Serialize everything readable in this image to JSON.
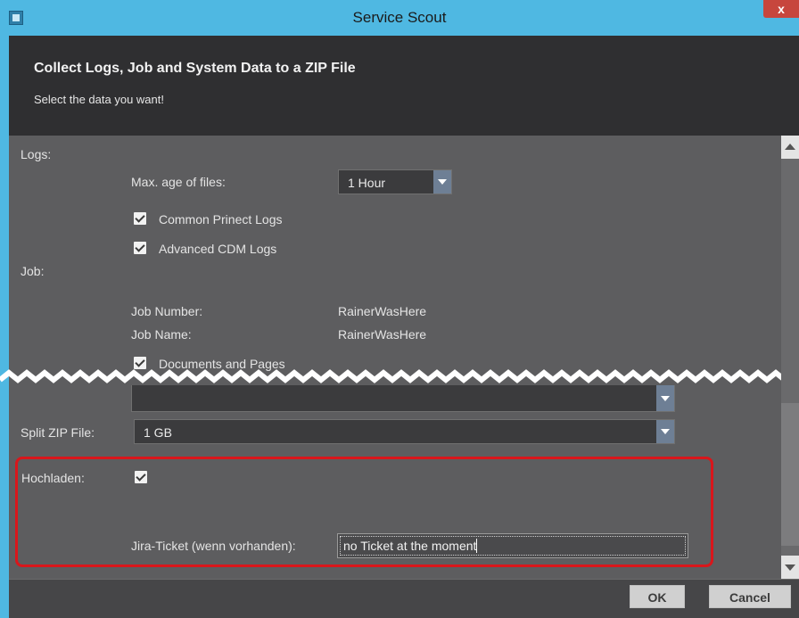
{
  "window": {
    "title": "Service Scout",
    "close_label": "x",
    "app_icon": "service-scout-icon"
  },
  "header": {
    "title": "Collect Logs, Job and System Data to a ZIP File",
    "subtitle": "Select the data you want!"
  },
  "logs": {
    "section_label": "Logs:",
    "max_age_label": "Max. age of files:",
    "max_age_value": "1 Hour",
    "checkboxes": [
      {
        "label": "Common Prinect Logs",
        "checked": true
      },
      {
        "label": "Advanced CDM Logs",
        "checked": true
      }
    ]
  },
  "job": {
    "section_label": "Job:",
    "number_label": "Job Number:",
    "number_value": "RainerWasHere",
    "name_label": "Job Name:",
    "name_value": "RainerWasHere",
    "documents_label": "Documents and Pages",
    "documents_checked": true
  },
  "split": {
    "label": "Split ZIP File:",
    "value": "1 GB"
  },
  "upload": {
    "label": "Hochladen:",
    "checked": true,
    "ticket_label": "Jira-Ticket (wenn vorhanden):",
    "ticket_value": "no Ticket at the moment"
  },
  "footer": {
    "ok_label": "OK",
    "cancel_label": "Cancel"
  },
  "colors": {
    "titlebar": "#4fb8e2",
    "header": "#2f2f31",
    "content": "#5d5d5f",
    "highlight": "#d9161b"
  }
}
